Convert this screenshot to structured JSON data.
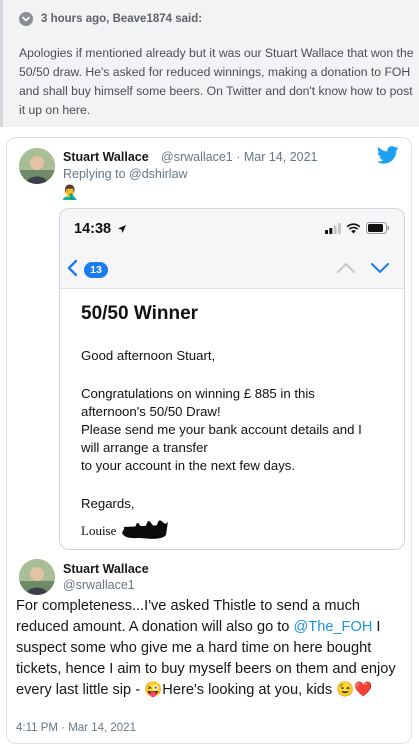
{
  "quote": {
    "meta": "3 hours ago, Beave1874 said:",
    "body": "Apologies if mentioned already but it was our Stuart Wallace that won the 50/50 draw. He's asked for reduced winnings, making a donation to FOH and shall buy himself some beers. On Twitter and don't know how to post it up on here."
  },
  "tweet1": {
    "name": "Stuart Wallace",
    "handle_date": "@srwallace1 · Mar 14, 2021",
    "replying_to": "Replying to @dshirlaw",
    "emoji": "🤦‍♂️"
  },
  "screenshot": {
    "time": "14:38",
    "badge_count": "13",
    "title": "50/50 Winner",
    "greeting": "Good afternoon Stuart,",
    "line1": "Congratulations on winning £ 885 in this",
    "line2": "afternoon's 50/50 Draw!",
    "line3": "Please send me your bank account details and I",
    "line4": "will arrange a transfer",
    "line5": "to your account in the next few days.",
    "regards": "Regards,",
    "signature": "Louise"
  },
  "tweet2": {
    "name": "Stuart Wallace",
    "handle": "@srwallace1",
    "text_part1": "For completeness...I've asked Thistle to send a much reduced amount. A donation will also go to ",
    "mention": "@The_FOH",
    "text_part2": " I suspect some who give me a hard time on here bought tickets, hence I aim to buy myself beers on them and enjoy every last little sip - 😜Here's looking at you, kids 😉❤️",
    "datetime": "4:11 PM · Mar 14, 2021"
  },
  "colors": {
    "twitter_blue": "#1da1f2",
    "ios_blue": "#1b7bf0",
    "mention": "#1b95e0"
  },
  "icons": {
    "quote_icon": "chevron-down-circle-icon",
    "twitter_logo": "twitter-bird-icon"
  }
}
